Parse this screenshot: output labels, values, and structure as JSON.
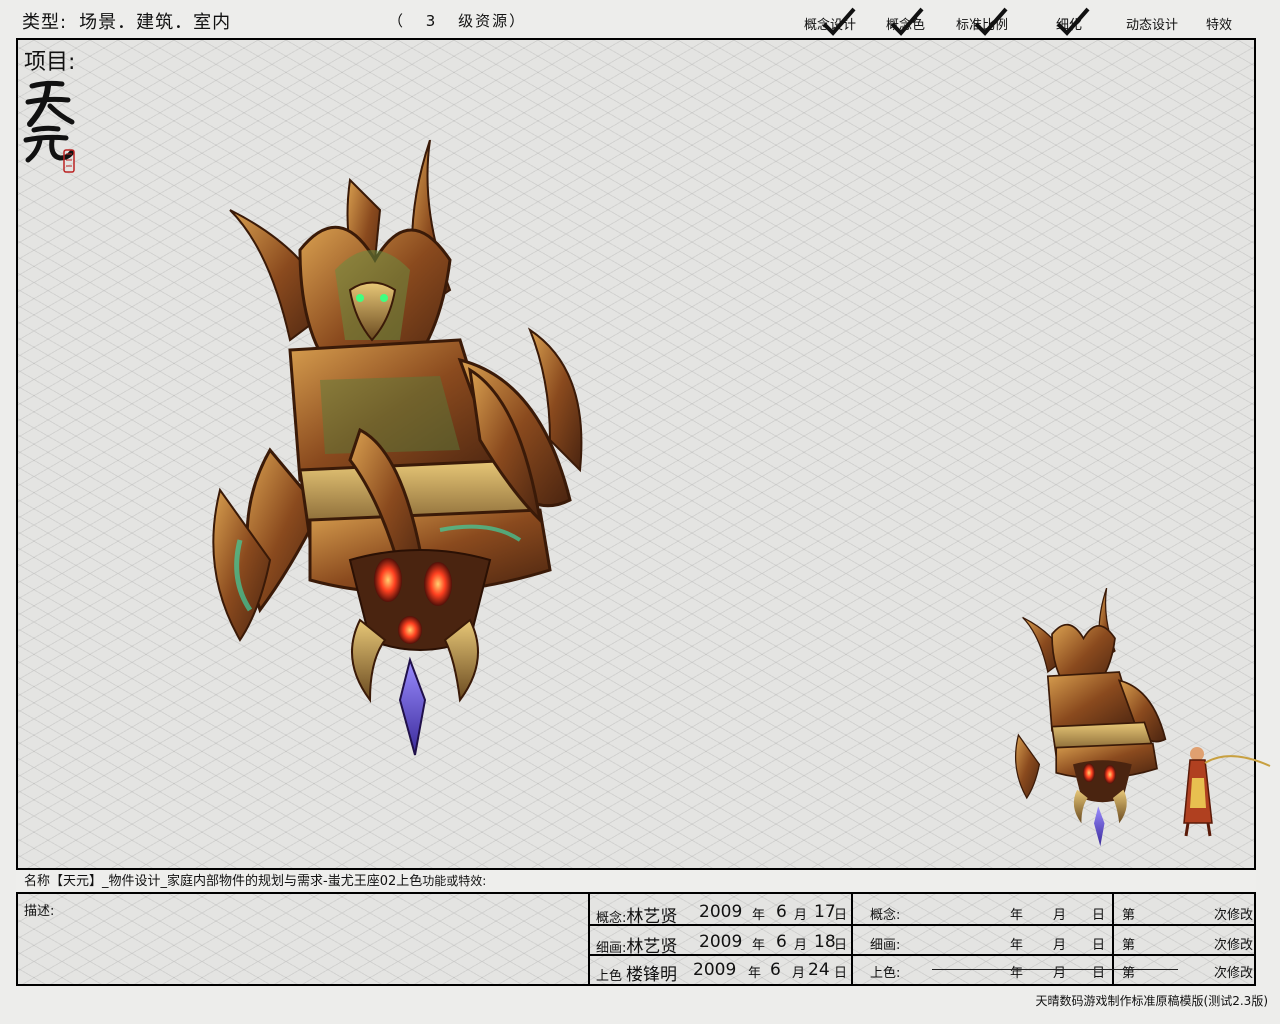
{
  "header": {
    "type_label": "类型:",
    "type_value": "场景．建筑．室内",
    "grade_open": "（",
    "grade_number": "3",
    "grade_label": "级资源）",
    "stages": [
      {
        "label": "概念设计",
        "checked": true
      },
      {
        "label": "概念色",
        "checked": true
      },
      {
        "label": "标准比例",
        "checked": true
      },
      {
        "label": "细化",
        "checked": true
      },
      {
        "label": "动态设计",
        "checked": false
      },
      {
        "label": "特效",
        "checked": false
      }
    ]
  },
  "project": {
    "label": "项目:",
    "logo_text": "天元"
  },
  "artwork": {
    "main_icon": "throne-icon",
    "preview_icon": "throne-with-character-icon"
  },
  "info": {
    "name_text": "名称【天元】_物件设计_家庭内部物件的规划与需求-蚩尤王座02上色",
    "feature_text": "功能或特效:",
    "desc_label": "描述:",
    "rows": [
      {
        "stage": "概念:",
        "person": "林艺贤",
        "year": "2009",
        "y": "年",
        "month": "6",
        "m": "月",
        "day": "17",
        "d": "日"
      },
      {
        "stage": "细画:",
        "person": "林艺贤",
        "year": "2009",
        "y": "年",
        "month": "6",
        "m": "月",
        "day": "18",
        "d": "日"
      },
      {
        "stage": "上色",
        "person": "楼锋明",
        "year": "2009",
        "y": "年",
        "month": "6",
        "m": "月",
        "day": "24",
        "d": "日"
      }
    ],
    "review_rows": [
      {
        "stage": "概念:",
        "y": "年",
        "m": "月",
        "d": "日",
        "nth": "第",
        "revise": "次修改"
      },
      {
        "stage": "细画:",
        "y": "年",
        "m": "月",
        "d": "日",
        "nth": "第",
        "revise": "次修改"
      },
      {
        "stage": "上色:",
        "y": "年",
        "m": "月",
        "d": "日",
        "nth": "第",
        "revise": "次修改"
      }
    ]
  },
  "footer": "天晴数码游戏制作标准原稿模版(测试2.3版)"
}
